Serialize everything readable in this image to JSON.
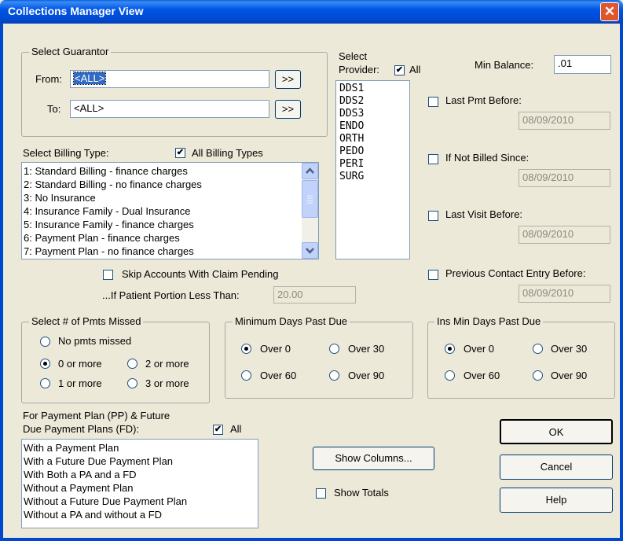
{
  "window": {
    "title": "Collections Manager View",
    "close_glyph": "✕"
  },
  "guarantor": {
    "legend": "Select Guarantor",
    "from_label": "From:",
    "from_value": "<ALL>",
    "to_label": "To:",
    "to_value": "<ALL>",
    "lookup_label": ">>"
  },
  "billing": {
    "label": "Select Billing Type:",
    "all_label": "All Billing Types",
    "all_checked": true,
    "items": [
      "1: Standard Billing - finance charges",
      "2: Standard Billing - no finance charges",
      "3: No Insurance",
      "4: Insurance Family - Dual Insurance",
      "5: Insurance Family - finance charges",
      "6: Payment Plan - finance charges",
      "7: Payment Plan - no finance charges"
    ]
  },
  "claim": {
    "skip_label": "Skip Accounts With Claim Pending",
    "skip_checked": false,
    "portion_label": "...If Patient Portion Less Than:",
    "portion_value": "20.00"
  },
  "provider": {
    "label_line1": "Select",
    "label_line2": "Provider:",
    "all_label": "All",
    "all_checked": true,
    "items": [
      "DDS1",
      "DDS2",
      "DDS3",
      "ENDO",
      "ORTH",
      "PEDO",
      "PERI",
      "SURG"
    ]
  },
  "filters": {
    "min_balance_label": "Min Balance:",
    "min_balance_value": ".01",
    "last_pmt_label": "Last Pmt Before:",
    "last_pmt_value": "08/09/2010",
    "not_billed_label": "If Not Billed Since:",
    "not_billed_value": "08/09/2010",
    "last_visit_label": "Last Visit Before:",
    "last_visit_value": "08/09/2010",
    "prev_contact_label": "Previous Contact Entry Before:",
    "prev_contact_value": "08/09/2010"
  },
  "pmts_missed": {
    "legend": "Select # of Pmts Missed",
    "options": [
      "No pmts missed",
      "0 or more",
      "2 or more",
      "1 or more",
      "3 or more"
    ],
    "selected": "0 or more"
  },
  "min_days": {
    "legend": "Minimum Days Past Due",
    "options": [
      "Over 0",
      "Over 30",
      "Over 60",
      "Over 90"
    ],
    "selected": "Over 0"
  },
  "ins_days": {
    "legend": "Ins Min Days Past Due",
    "options": [
      "Over 0",
      "Over 30",
      "Over 60",
      "Over 90"
    ],
    "selected": "Over 0"
  },
  "payment_plans": {
    "label_line1": "For Payment Plan (PP) & Future",
    "label_line2": "Due Payment Plans (FD):",
    "all_label": "All",
    "all_checked": true,
    "items": [
      "With a Payment Plan",
      "With a Future Due Payment Plan",
      "With Both a PA and a FD",
      "Without a Payment Plan",
      "Without a Future Due Payment Plan",
      "Without a PA and without a FD"
    ]
  },
  "actions": {
    "show_columns": "Show Columns...",
    "show_totals_label": "Show Totals",
    "show_totals_checked": false,
    "ok": "OK",
    "cancel": "Cancel",
    "help": "Help"
  }
}
